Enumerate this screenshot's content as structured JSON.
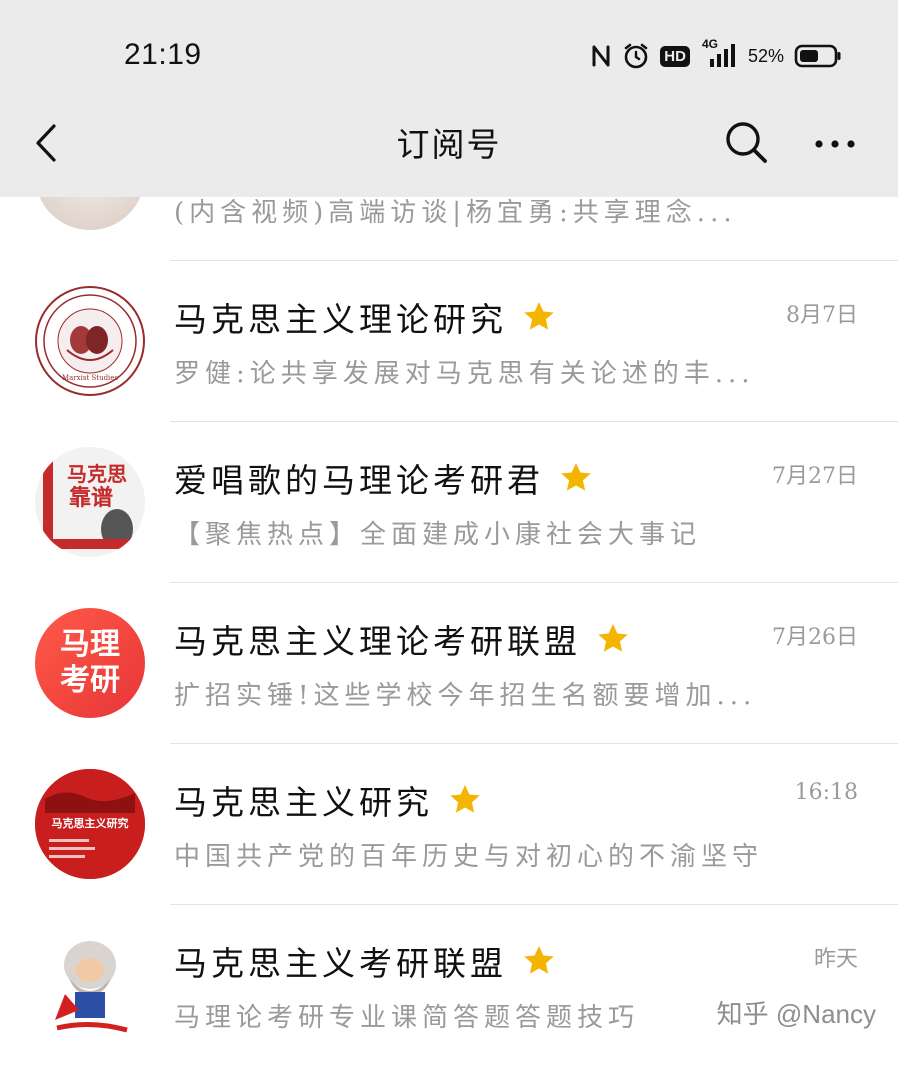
{
  "status_bar": {
    "time": "21:19",
    "network": "4G",
    "hd_label": "HD",
    "battery": "52%",
    "icons": [
      "nfc-icon",
      "alarm-icon",
      "hd-icon",
      "signal-icon",
      "battery-icon"
    ]
  },
  "nav": {
    "title": "订阅号",
    "icons": [
      "back-arrow-icon",
      "search-icon",
      "more-icon"
    ]
  },
  "colors": {
    "header_bg": "#ebebeb",
    "star": "#f5b400",
    "muted_text": "#9a9a9a",
    "divider": "#e3e3e3"
  },
  "partial_item": {
    "preview": "(内含视频)高端访谈|杨宜勇:共享理念..."
  },
  "items": [
    {
      "name": "马克思主义理论研究",
      "date": "8月7日",
      "preview": "罗健:论共享发展对马克思有关论述的丰...",
      "starred": true,
      "avatar": "marxist-studies-seal"
    },
    {
      "name": "爱唱歌的马理论考研君",
      "date": "7月27日",
      "preview": "【聚焦热点】全面建成小康社会大事记",
      "starred": true,
      "avatar": "book-cover",
      "avatar_text": "马克思靠谱"
    },
    {
      "name": "马克思主义理论考研联盟",
      "date": "7月26日",
      "preview": "扩招实锤!这些学校今年招生名额要增加...",
      "starred": true,
      "avatar": "text-badge",
      "avatar_text": [
        "马理",
        "考研"
      ]
    },
    {
      "name": "马克思主义研究",
      "date": "16:18",
      "preview": "中国共产党的百年历史与对初心的不渝坚守",
      "starred": true,
      "avatar": "journal-cover",
      "avatar_text": "马克思主义研究"
    },
    {
      "name": "马克思主义考研联盟",
      "date": "昨天",
      "preview": "马理论考研专业课简答题答题技巧",
      "starred": true,
      "avatar": "cartoon-marx"
    }
  ],
  "watermark": "知乎 @Nancy"
}
